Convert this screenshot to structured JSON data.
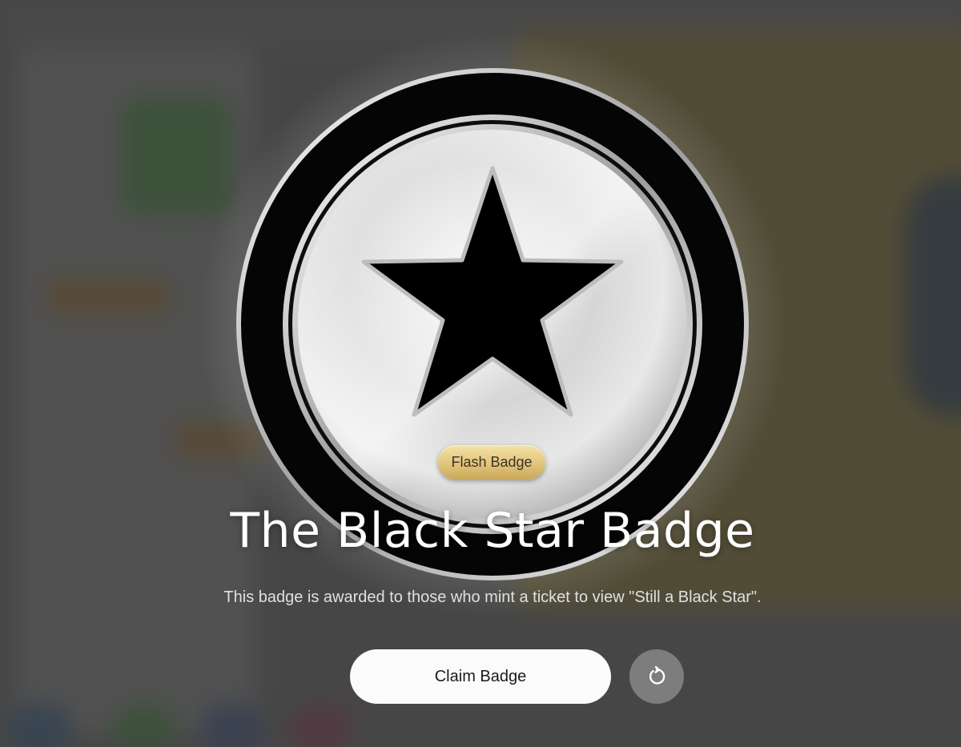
{
  "badge": {
    "tag_label": "Flash Badge",
    "title": "The Black Star Badge",
    "description": "This badge is awarded to those who mint a ticket to view \"Still a Black Star\".",
    "icon": "black-star-icon"
  },
  "actions": {
    "claim_label": "Claim Badge",
    "refresh_icon": "refresh-icon"
  },
  "colors": {
    "tag_gold": "#e2c47a",
    "ring": "#000000",
    "silver": "#d9d9d9",
    "button_bg": "#fbfbfb",
    "refresh_bg": "#7d7d7d"
  }
}
